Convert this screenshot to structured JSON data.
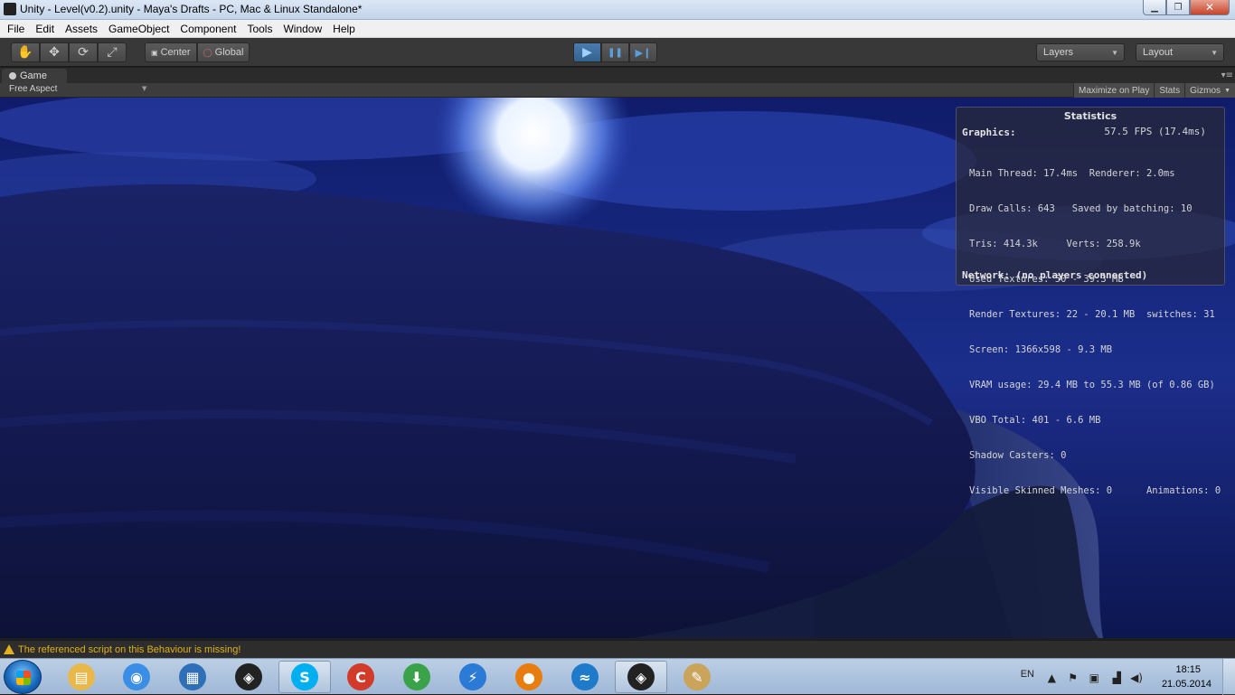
{
  "window": {
    "title": "Unity - Level(v0.2).unity - Maya's Drafts - PC, Mac & Linux Standalone*",
    "minimize_glyph": "▁",
    "maximize_glyph": "❐",
    "close_glyph": "✕"
  },
  "menu": [
    "File",
    "Edit",
    "Assets",
    "GameObject",
    "Component",
    "Tools",
    "Window",
    "Help"
  ],
  "toolbar": {
    "tools": [
      {
        "icon": "hand-icon",
        "glyph": "✋"
      },
      {
        "icon": "move-icon",
        "glyph": "✥"
      },
      {
        "icon": "rotate-icon",
        "glyph": "⟳"
      },
      {
        "icon": "scale-icon",
        "glyph": "⤢"
      }
    ],
    "pivot": "Center",
    "space": "Global",
    "play_glyph": "▶",
    "pause_glyph": "❚❚",
    "step_glyph": "▶❙",
    "layers_label": "Layers",
    "layout_label": "Layout"
  },
  "game_panel": {
    "tab_label": "Game",
    "aspect": "Free Aspect",
    "maximize_on_play": "Maximize on Play",
    "stats": "Stats",
    "gizmos": "Gizmos"
  },
  "statistics": {
    "title": "Statistics",
    "graphics_label": "Graphics:",
    "fps": "57.5 FPS (17.4ms)",
    "lines": [
      "Main Thread: 17.4ms  Renderer: 2.0ms",
      "Draw Calls: 643   Saved by batching: 10",
      "Tris: 414.3k     Verts: 258.9k",
      "Used Textures: 50 - 39.3 MB",
      "Render Textures: 22 - 20.1 MB  switches: 31",
      "Screen: 1366x598 - 9.3 MB",
      "VRAM usage: 29.4 MB to 55.3 MB (of 0.86 GB)",
      "VBO Total: 401 - 6.6 MB",
      "Shadow Casters: 0",
      "Visible Skinned Meshes: 0      Animations: 0"
    ],
    "network": "Network: (no players connected)"
  },
  "status_bar": {
    "message": "The referenced script on this Behaviour is missing!"
  },
  "taskbar": {
    "apps": [
      {
        "name": "explorer",
        "color": "#e8b84a",
        "glyph": "▤",
        "active": false
      },
      {
        "name": "chrome",
        "color": "#3a8ee6",
        "glyph": "◉",
        "active": false
      },
      {
        "name": "app-blocks",
        "color": "#2f6fb8",
        "glyph": "▦",
        "active": false
      },
      {
        "name": "unity",
        "color": "#222222",
        "glyph": "◈",
        "active": false
      },
      {
        "name": "skype",
        "color": "#00aff0",
        "glyph": "S",
        "active": true
      },
      {
        "name": "ccleaner",
        "color": "#d23a2a",
        "glyph": "C",
        "active": false
      },
      {
        "name": "download-manager",
        "color": "#3aa34a",
        "glyph": "⬇",
        "active": false
      },
      {
        "name": "flash-app",
        "color": "#2a7ad6",
        "glyph": "⚡",
        "active": false
      },
      {
        "name": "blender",
        "color": "#e87d0d",
        "glyph": "●",
        "active": false
      },
      {
        "name": "paint-dot-net-style",
        "color": "#1f7ac9",
        "glyph": "≈",
        "active": false
      },
      {
        "name": "unity-editor",
        "color": "#222222",
        "glyph": "◈",
        "active": true
      },
      {
        "name": "paint",
        "color": "#c9a45a",
        "glyph": "✎",
        "active": false
      }
    ],
    "language": "EN",
    "time": "18:15",
    "date": "21.05.2014"
  },
  "colors": {
    "warning": "#e0b020",
    "play_active": "#3d6ea0"
  }
}
